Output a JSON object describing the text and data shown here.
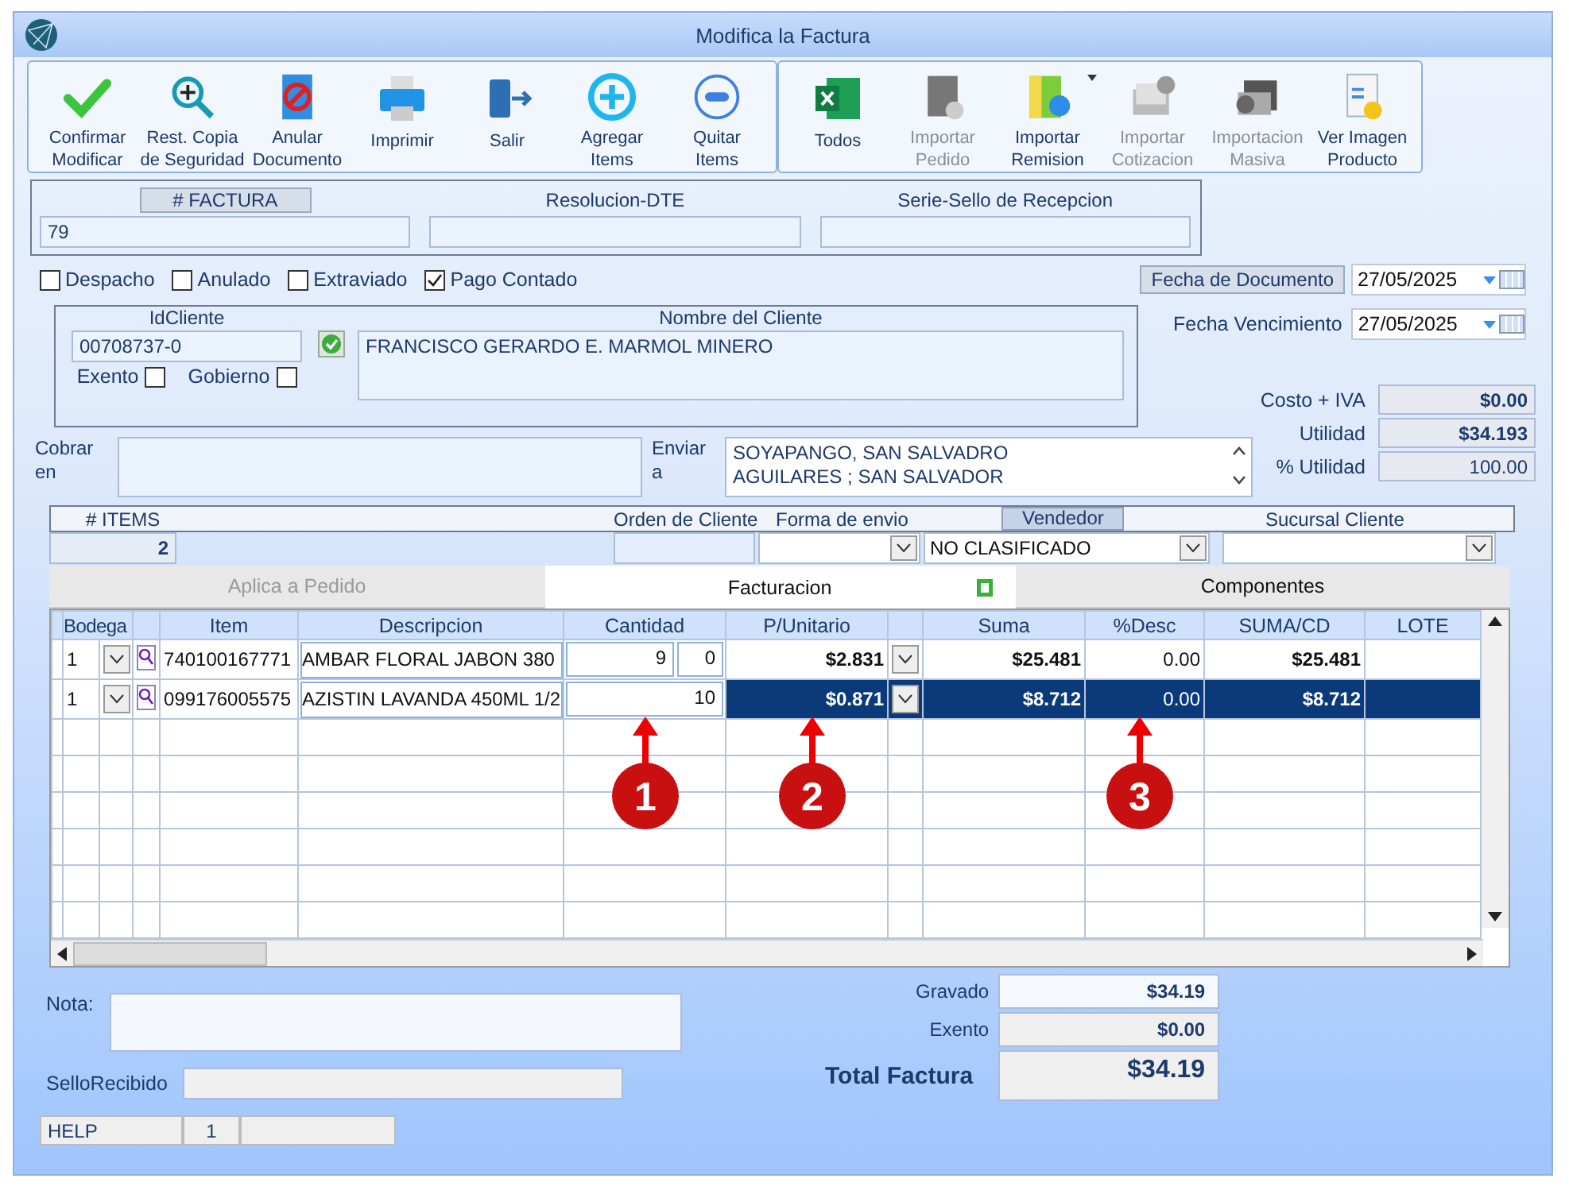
{
  "window": {
    "title": "Modifica la Factura"
  },
  "toolbar_groups": [
    {
      "buttons": [
        {
          "kind": "check",
          "lines": [
            "Confirmar",
            "Modificar"
          ],
          "disabled": false
        },
        {
          "kind": "magnifier",
          "lines": [
            "Rest. Copia",
            "de Seguridad"
          ],
          "disabled": false
        },
        {
          "kind": "cancel",
          "lines": [
            "Anular",
            "Documento"
          ],
          "disabled": false
        },
        {
          "kind": "printer",
          "lines": [
            "Imprimir"
          ],
          "disabled": false
        },
        {
          "kind": "exit",
          "lines": [
            "Salir"
          ],
          "disabled": false
        },
        {
          "kind": "plus",
          "lines": [
            "Agregar",
            "Items"
          ],
          "disabled": false
        },
        {
          "kind": "minus",
          "lines": [
            "Quitar",
            "Items"
          ],
          "disabled": false
        }
      ]
    },
    {
      "buttons": [
        {
          "kind": "sheet",
          "lines": [
            "Todos"
          ],
          "disabled": false
        },
        {
          "kind": "pedido",
          "lines": [
            "Importar",
            "Pedido"
          ],
          "disabled": true
        },
        {
          "kind": "remision",
          "lines": [
            "Importar",
            "Remision"
          ],
          "disabled": false,
          "dropdown": true
        },
        {
          "kind": "cotizacion",
          "lines": [
            "Importar",
            "Cotizacion"
          ],
          "disabled": true
        },
        {
          "kind": "masiva",
          "lines": [
            "Importacion",
            "Masiva"
          ],
          "disabled": true
        },
        {
          "kind": "imagen",
          "lines": [
            "Ver Imagen",
            "Producto"
          ],
          "disabled": false
        }
      ]
    }
  ],
  "header_fields": [
    {
      "label": "# FACTURA",
      "kind": "tag",
      "value": "79"
    },
    {
      "label": "Resolucion-DTE",
      "kind": "plain"
    },
    {
      "label": "Serie-Sello de Recepcion",
      "kind": "plain"
    }
  ],
  "options": [
    {
      "label": "Despacho",
      "checked": false
    },
    {
      "label": "Anulado",
      "checked": false
    },
    {
      "label": "Extraviado",
      "checked": false
    },
    {
      "label": "Pago Contado",
      "checked": true
    }
  ],
  "fecha_documento": {
    "label": "Fecha de  Documento",
    "value": "27/05/2025"
  },
  "cliente": {
    "id_label": "IdCliente",
    "id": "00708737-0",
    "name_label": "Nombre del Cliente",
    "name": "FRANCISCO GERARDO E. MARMOL MINERO",
    "flags": [
      {
        "label": "Exento",
        "checked": false
      },
      {
        "label": "Gobierno",
        "checked": false
      }
    ]
  },
  "fecha_vencimiento": {
    "label": "Fecha Vencimiento",
    "value": "27/05/2025"
  },
  "summary": [
    {
      "label": "Costo + IVA",
      "value": "$0.00",
      "bold": true
    },
    {
      "label": "Utilidad",
      "value": "$34.193",
      "bold": true
    },
    {
      "label": "% Utilidad",
      "value": "100.00",
      "bold": false
    }
  ],
  "cobrar": {
    "lines": [
      "Cobrar",
      "en"
    ]
  },
  "enviar": {
    "lines": [
      "Enviar",
      "a"
    ],
    "value_lines": [
      "SOYAPANGO, SAN SALVADRO",
      "AGUILARES ; SAN SALVADOR"
    ]
  },
  "order_bar": {
    "items_label": "# ITEMS",
    "items_count": "2",
    "orden_label": "Orden de Cliente",
    "forma_label": "Forma de envio",
    "vendedor_label": "Vendedor",
    "vendedor": "NO CLASIFICADO",
    "sucursal_label": "Sucursal Cliente"
  },
  "tabs": [
    {
      "label": "Aplica a Pedido",
      "selected": false,
      "disabled": true
    },
    {
      "label": "Facturacion",
      "selected": true,
      "disabled": false
    },
    {
      "label": "Componentes",
      "selected": false,
      "disabled": false
    }
  ],
  "table": {
    "columns": [
      "Bodega",
      "Item",
      "Descripcion",
      "Cantidad",
      "P/Unitario",
      "Suma",
      "%Desc",
      "SUMA/CD",
      "LOTE"
    ],
    "rows": [
      {
        "bodega": "1",
        "item": "740100167771",
        "descripcion": "AMBAR FLORAL JABON 380",
        "cantidad": [
          "9",
          "0"
        ],
        "precio": "$2.831",
        "suma": "$25.481",
        "desc": "0.00",
        "suma_cd": "$25.481",
        "selected": false
      },
      {
        "bodega": "1",
        "item": "099176005575",
        "descripcion": "AZISTIN LAVANDA 450ML 1/2",
        "cantidad": [
          "10"
        ],
        "precio": "$0.871",
        "suma": "$8.712",
        "desc": "0.00",
        "suma_cd": "$8.712",
        "selected": true
      }
    ]
  },
  "annotations": [
    "1",
    "2",
    "3"
  ],
  "nota_label": "Nota:",
  "sello_label": "SelloRecibido",
  "totals": [
    {
      "label": "Gravado",
      "value": "$34.19",
      "kind": "normal"
    },
    {
      "label": "Exento",
      "value": "$0.00",
      "kind": "normal"
    },
    {
      "label": "Total Factura",
      "value": "$34.19",
      "kind": "grand"
    }
  ],
  "status_bar": [
    "HELP",
    "1"
  ]
}
